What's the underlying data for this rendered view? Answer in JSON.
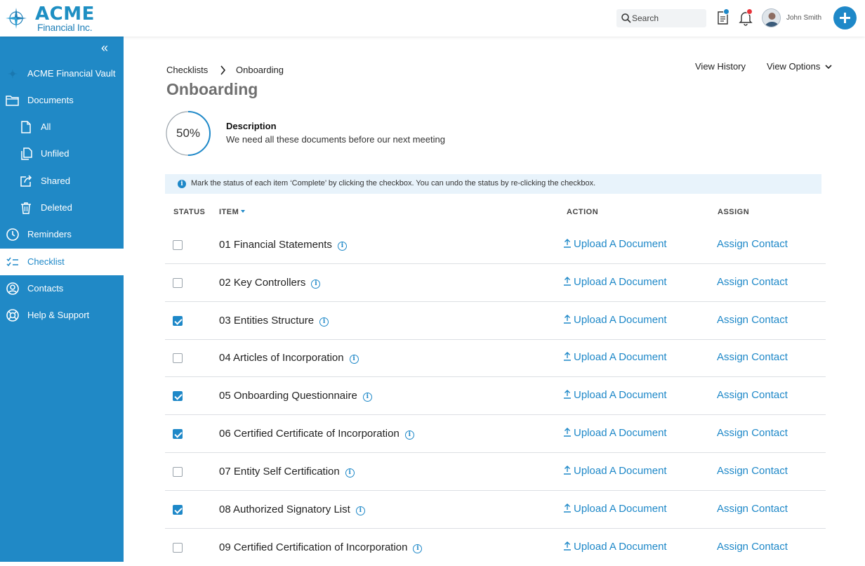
{
  "brand": {
    "name": "ACME",
    "sub": "Financial Inc."
  },
  "header": {
    "search_placeholder": "Search",
    "user_name": "John Smith",
    "colors": {
      "accent": "#1e88c8",
      "badge": "#e8343b",
      "badge_docs": "#1e88c8"
    }
  },
  "sidebar": {
    "collapse_glyph": "«",
    "items": [
      {
        "label": "ACME Financial Vault",
        "icon": "vault-icon"
      },
      {
        "label": "Documents",
        "icon": "folder-icon"
      },
      {
        "label": "All",
        "icon": "file-icon"
      },
      {
        "label": "Unfiled",
        "icon": "copy-icon"
      },
      {
        "label": "Shared",
        "icon": "share-icon"
      },
      {
        "label": "Deleted",
        "icon": "trash-icon"
      },
      {
        "label": "Reminders",
        "icon": "clock-icon"
      },
      {
        "label": "Checklist",
        "icon": "checklist-icon"
      },
      {
        "label": "Contacts",
        "icon": "contact-icon"
      },
      {
        "label": "Help & Support",
        "icon": "lifebuoy-icon"
      }
    ]
  },
  "main": {
    "breadcrumb": [
      "Checklists",
      "Onboarding"
    ],
    "title": "Onboarding",
    "view_history": "View History",
    "view_options": "View Options",
    "progress_label": "50%",
    "progress_fraction": 0.5,
    "description_heading": "Description",
    "description_text": "We need all these documents before our next meeting",
    "info_text": "Mark the status of each item ‘Complete’ by clicking the checkbox. You can undo the status by re-clicking the checkbox.",
    "columns": {
      "status": "STATUS",
      "item": "ITEM",
      "action": "ACTION",
      "assign": "ASSIGN"
    },
    "action_label": "Upload A Document",
    "assign_label": "Assign Contact",
    "rows": [
      {
        "name": "01 Financial Statements",
        "checked": false
      },
      {
        "name": "02 Key Controllers",
        "checked": false
      },
      {
        "name": "03 Entities Structure",
        "checked": true
      },
      {
        "name": "04 Articles of Incorporation",
        "checked": false
      },
      {
        "name": "05 Onboarding Questionnaire",
        "checked": true
      },
      {
        "name": "06 Certified Certificate of Incorporation",
        "checked": true
      },
      {
        "name": "07 Entity Self Certification",
        "checked": false
      },
      {
        "name": "08 Authorized Signatory List",
        "checked": true
      },
      {
        "name": "09 Certified Certification of Incorporation",
        "checked": false
      }
    ]
  }
}
